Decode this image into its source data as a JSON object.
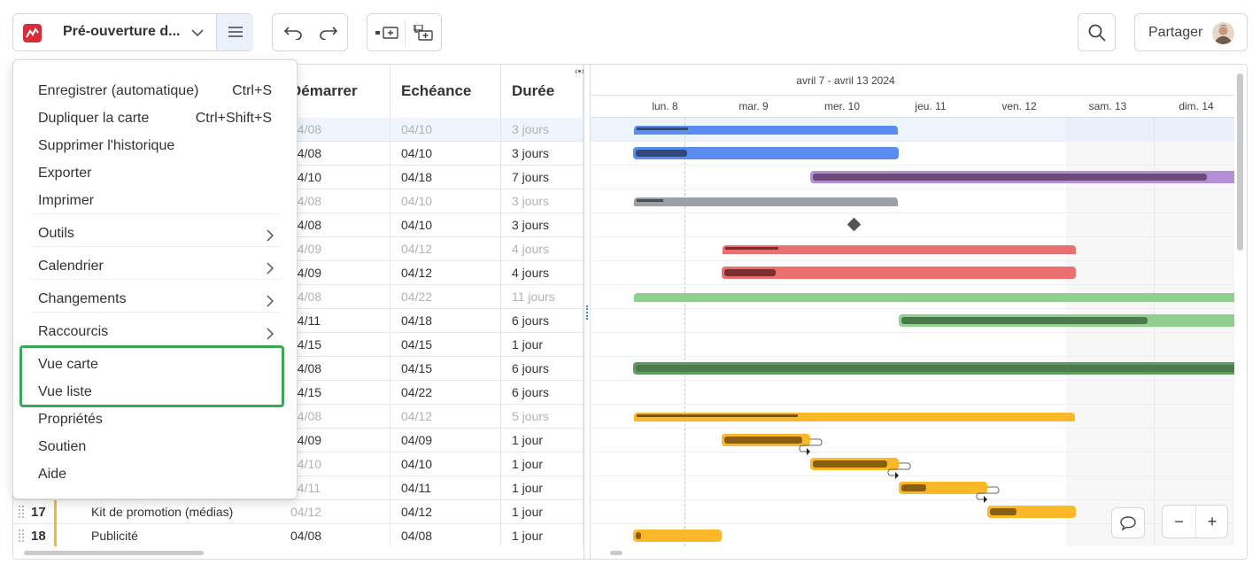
{
  "toolbar": {
    "map_title": "Pré-ouverture d...",
    "share_label": "Partager"
  },
  "menu": {
    "items": [
      {
        "label": "Enregistrer (automatique)",
        "shortcut": "Ctrl+S"
      },
      {
        "label": "Dupliquer la carte",
        "shortcut": "Ctrl+Shift+S"
      },
      {
        "label": "Supprimer l'historique"
      },
      {
        "label": "Exporter"
      },
      {
        "label": "Imprimer"
      },
      {
        "label": "Outils",
        "submenu": true
      },
      {
        "label": "Calendrier",
        "submenu": true
      },
      {
        "label": "Changements",
        "submenu": true
      },
      {
        "label": "Raccourcis",
        "submenu": true
      },
      {
        "label": "Vue carte"
      },
      {
        "label": "Vue liste"
      },
      {
        "label": "Propriétés"
      },
      {
        "label": "Soutien"
      },
      {
        "label": "Aide"
      }
    ],
    "highlight_color": "#3aa757"
  },
  "grid": {
    "headers": {
      "start": "Démarrer",
      "due": "Echéance",
      "duration": "Durée"
    },
    "rows": [
      {
        "start": "04/08",
        "due": "04/10",
        "duration": "3 jours",
        "dim": true
      },
      {
        "start": "04/08",
        "due": "04/10",
        "duration": "3 jours"
      },
      {
        "start": "04/10",
        "due": "04/18",
        "duration": "7 jours"
      },
      {
        "start": "04/08",
        "due": "04/10",
        "duration": "3 jours",
        "dim": true
      },
      {
        "start": "04/08",
        "due": "04/10",
        "duration": "3 jours"
      },
      {
        "start": "04/09",
        "due": "04/12",
        "duration": "4 jours",
        "dim": true
      },
      {
        "start": "04/09",
        "due": "04/12",
        "duration": "4 jours"
      },
      {
        "start": "04/08",
        "due": "04/22",
        "duration": "11 jours",
        "dim": true
      },
      {
        "start": "04/11",
        "due": "04/18",
        "duration": "6 jours"
      },
      {
        "start": "04/15",
        "due": "04/15",
        "duration": "1 jour"
      },
      {
        "start": "04/08",
        "due": "04/15",
        "duration": "6 jours"
      },
      {
        "start": "04/15",
        "due": "04/22",
        "duration": "6 jours"
      },
      {
        "start": "04/08",
        "due": "04/12",
        "duration": "5 jours",
        "dim": true
      },
      {
        "start": "04/09",
        "due": "04/09",
        "duration": "1 jour"
      },
      {
        "start": "04/10",
        "due": "04/10",
        "duration": "1 jour",
        "startDim": true
      },
      {
        "start": "04/11",
        "due": "04/11",
        "duration": "1 jour",
        "startDim": true
      },
      {
        "num": "17",
        "name": "Kit de promotion (médias)",
        "start": "04/12",
        "due": "04/12",
        "duration": "1 jour",
        "startDim": true
      },
      {
        "num": "18",
        "name": "Publicité",
        "start": "04/08",
        "due": "04/08",
        "duration": "1 jour"
      }
    ]
  },
  "timeline": {
    "range_label": "avril 7 - avril 13 2024",
    "days": [
      "lun. 8",
      "mar. 9",
      "mer. 10",
      "jeu. 11",
      "ven. 12",
      "sam. 13",
      "dim. 14"
    ]
  },
  "colors": {
    "blue": "#5b8def",
    "purple": "#b48fd6",
    "gray": "#9aa0a6",
    "red": "#ea7070",
    "green": "#8fcf8f",
    "darkgreen": "#5e9b5e",
    "yellow": "#fbb929"
  }
}
